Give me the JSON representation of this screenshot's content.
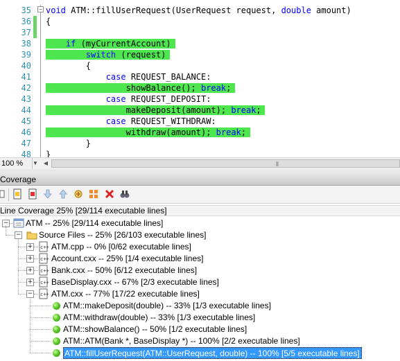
{
  "editor": {
    "lines": [
      {
        "num": "35",
        "tokens": [
          {
            "t": "void",
            "kw": true
          },
          {
            "t": " ATM::fillUserRequest(UserRequest request, "
          },
          {
            "t": "double",
            "kw": true
          },
          {
            "t": " amount)"
          }
        ],
        "changed": false
      },
      {
        "num": "36",
        "tokens": [
          {
            "t": "{"
          }
        ],
        "changed": true
      },
      {
        "num": "37",
        "tokens": [
          {
            "t": ""
          }
        ],
        "changed": true
      },
      {
        "num": "38",
        "tokens": [
          {
            "t": "    "
          },
          {
            "t": "if",
            "kw": true
          },
          {
            "t": " (myCurrentAccount)"
          }
        ],
        "changed": false,
        "covered": true
      },
      {
        "num": "39",
        "tokens": [
          {
            "t": "        "
          },
          {
            "t": "switch",
            "kw": true
          },
          {
            "t": " (request)"
          }
        ],
        "changed": false,
        "covered": true
      },
      {
        "num": "40",
        "tokens": [
          {
            "t": "        {"
          }
        ],
        "changed": false
      },
      {
        "num": "41",
        "tokens": [
          {
            "t": "            "
          },
          {
            "t": "case",
            "kw": true
          },
          {
            "t": " REQUEST_BALANCE:"
          }
        ],
        "changed": false
      },
      {
        "num": "42",
        "tokens": [
          {
            "t": "                showBalance(); "
          },
          {
            "t": "break",
            "kw": true
          },
          {
            "t": ";"
          }
        ],
        "changed": false,
        "covered": true
      },
      {
        "num": "43",
        "tokens": [
          {
            "t": "            "
          },
          {
            "t": "case",
            "kw": true
          },
          {
            "t": " REQUEST_DEPOSIT:"
          }
        ],
        "changed": false
      },
      {
        "num": "44",
        "tokens": [
          {
            "t": "                makeDeposit(amount); "
          },
          {
            "t": "break",
            "kw": true
          },
          {
            "t": ";"
          }
        ],
        "changed": false,
        "covered": true
      },
      {
        "num": "45",
        "tokens": [
          {
            "t": "            "
          },
          {
            "t": "case",
            "kw": true
          },
          {
            "t": " REQUEST_WITHDRAW:"
          }
        ],
        "changed": false
      },
      {
        "num": "46",
        "tokens": [
          {
            "t": "                withdraw(amount); "
          },
          {
            "t": "break",
            "kw": true
          },
          {
            "t": ";"
          }
        ],
        "changed": false,
        "covered": true
      },
      {
        "num": "47",
        "tokens": [
          {
            "t": "        }"
          }
        ],
        "changed": false
      },
      {
        "num": "48",
        "tokens": [
          {
            "t": "}"
          }
        ],
        "changed": false
      }
    ],
    "zoom": "100 %"
  },
  "coverage": {
    "title": "Coverage",
    "summary": "Line Coverage 25% [29/114 executable lines]",
    "tree": {
      "root": "ATM -- 25% [29/114 executable lines]",
      "source_files": "Source Files -- 25% [26/103 executable lines]",
      "files": [
        "ATM.cpp -- 0% [0/62 executable lines]",
        "Account.cxx -- 25% [1/4 executable lines]",
        "Bank.cxx -- 50% [6/12 executable lines]",
        "BaseDisplay.cxx -- 67% [2/3 executable lines]",
        "ATM.cxx -- 77% [17/22 executable lines]"
      ],
      "functions": [
        "ATM::makeDeposit(double) -- 33% [1/3 executable lines]",
        "ATM::withdraw(double) -- 33% [1/3 executable lines]",
        "ATM::showBalance() -- 50% [1/2 executable lines]",
        "ATM::ATM(Bank *, BaseDisplay *) -- 100% [2/2 executable lines]",
        "ATM::fillUserRequest(ATM::UserRequest, double) -- 100% [5/5 executable lines]"
      ],
      "selected_function": 4
    }
  },
  "colors": {
    "covered_highlight": "#4ee64e",
    "changed_margin": "#6bd46b",
    "selection": "#3399ff",
    "keyword": "#0000ff",
    "line_number": "#2b91af"
  }
}
